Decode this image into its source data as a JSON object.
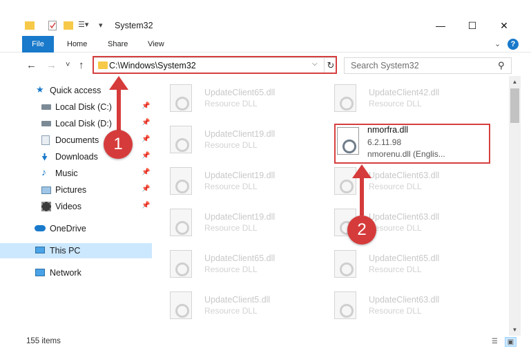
{
  "window": {
    "title": "System32",
    "minimize": "—",
    "maximize": "☐",
    "close": "✕"
  },
  "ribbon": {
    "file": "File",
    "home": "Home",
    "share": "Share",
    "view": "View",
    "help": "?"
  },
  "nav": {
    "back": "←",
    "forward": "→",
    "recent": "˅",
    "up": "↑",
    "address": "C:\\Windows\\System32",
    "search_placeholder": "Search System32"
  },
  "sidebar": {
    "items": [
      {
        "label": "Quick access",
        "icon": "star-icon"
      },
      {
        "label": "Local Disk (C:)",
        "icon": "drive-icon"
      },
      {
        "label": "Local Disk (D:)",
        "icon": "drive-icon"
      },
      {
        "label": "Documents",
        "icon": "documents-icon"
      },
      {
        "label": "Downloads",
        "icon": "download-icon"
      },
      {
        "label": "Music",
        "icon": "music-icon"
      },
      {
        "label": "Pictures",
        "icon": "pictures-icon"
      },
      {
        "label": "Videos",
        "icon": "videos-icon"
      },
      {
        "label": "OneDrive",
        "icon": "cloud-icon"
      },
      {
        "label": "This PC",
        "icon": "computer-icon"
      },
      {
        "label": "Network",
        "icon": "network-icon"
      }
    ]
  },
  "files": [
    {
      "name": "UpdateClient65.dll",
      "desc": "Resource DLL"
    },
    {
      "name": "UpdateClient42.dll",
      "desc": "Resource DLL"
    },
    {
      "name": "UpdateClient19.dll",
      "desc": "Resource DLL"
    },
    {
      "name": "nmorfra.dll",
      "desc": "6.2.11.98",
      "desc2": "nmorenu.dll (Englis..."
    },
    {
      "name": "UpdateClient19.dll",
      "desc": "Resource DLL"
    },
    {
      "name": "UpdateClient63.dll",
      "desc": "Resource DLL"
    },
    {
      "name": "UpdateClient19.dll",
      "desc": "Resource DLL"
    },
    {
      "name": "UpdateClient63.dll",
      "desc": "Resource DLL"
    },
    {
      "name": "UpdateClient65.dll",
      "desc": "Resource DLL"
    },
    {
      "name": "UpdateClient65.dll",
      "desc": "Resource DLL"
    },
    {
      "name": "UpdateClient5.dll",
      "desc": "Resource DLL"
    },
    {
      "name": "UpdateClient63.dll",
      "desc": "Resource DLL"
    }
  ],
  "status": {
    "count": "155 items"
  },
  "annotations": {
    "step1": "1",
    "step2": "2",
    "color": "#d63b3b"
  }
}
